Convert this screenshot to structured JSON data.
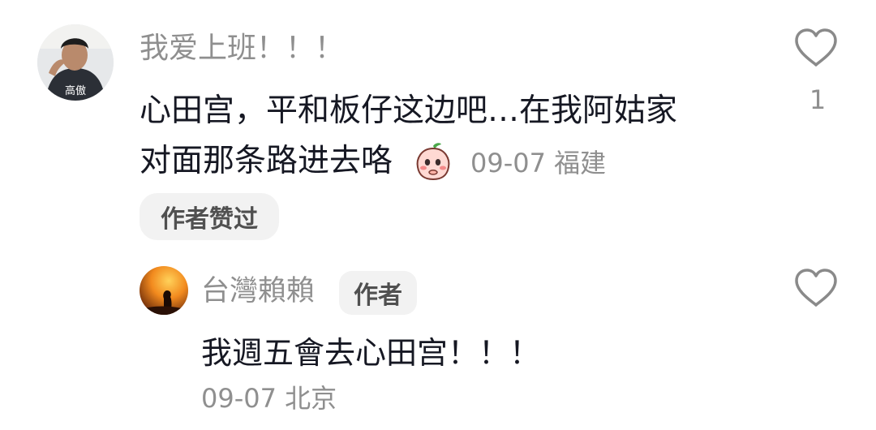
{
  "comment": {
    "author_name": "我爱上班！！！",
    "avatar_text": "高傲",
    "text_line1": "心田宫，平和板仔这边吧…在我阿姑家",
    "text_line2": "对面那条路进去咯",
    "emoji": "shy-peach-emoji",
    "date": "09-07",
    "location": "福建",
    "liked_by_author_label": "作者赞过",
    "like_count": "1"
  },
  "reply": {
    "author_name": "台灣賴賴",
    "author_badge": "作者",
    "text": "我週五會去心田宫！！！",
    "date": "09-07",
    "location": "北京"
  },
  "colors": {
    "text_primary": "#161823",
    "text_secondary": "#8f8f8f",
    "pill_bg": "#f2f2f2"
  }
}
